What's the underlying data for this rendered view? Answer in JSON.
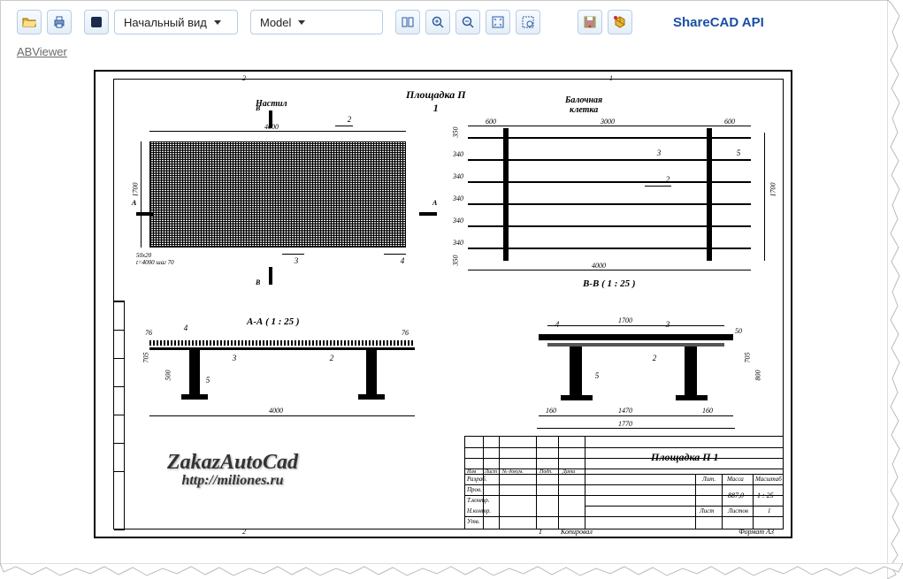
{
  "toolbar": {
    "view_select": "Начальный вид",
    "model_select": "Model",
    "api_link": "ShareCAD API"
  },
  "footer_link": "ABViewer",
  "drawing": {
    "main_title": "Площадка П",
    "main_title2": "1",
    "plan_label": "Настил",
    "beam_label": "Балочная\nклетка",
    "section_aa": "А-А ( 1 : 25 )",
    "section_bb": "В-В ( 1 : 25 )",
    "marks": {
      "a": "А",
      "b": "В"
    },
    "dims": {
      "w4000": "4000",
      "h1700": "1700",
      "d600_1": "600",
      "d3000": "3000",
      "d600_2": "600",
      "d340": "340",
      "grid_note": "50х20\nt=4000 шаг 70",
      "d705": "705",
      "d500": "500",
      "d76": "76",
      "d160": "160",
      "d1470": "1470",
      "d1770": "1770",
      "d1700e": "1700",
      "d800": "800",
      "d50_1": "50",
      "d350": "350"
    },
    "refs": {
      "r2": "2",
      "r3": "3",
      "r4": "4",
      "r5": "5"
    }
  },
  "titleblock": {
    "name": "Площадка П 1",
    "mass": "887,0",
    "scale": "1 : 25",
    "sheet": "Лист",
    "sheets": "Листов",
    "sheets_n": "1",
    "format": "Формат А3",
    "col_mass": "Масса",
    "col_scale": "Масштаб",
    "col_lit": "Лит.",
    "bottom_center": "Копировал",
    "left_labels": [
      "Разраб.",
      "Пров.",
      "Т.контр.",
      "Н.контр.",
      "Утв."
    ],
    "left_head": [
      "Изм",
      "Лист",
      "№ докум.",
      "Подп.",
      "Дата"
    ]
  },
  "watermark": {
    "line1": "ZakazAutoCad",
    "line2": "http://miliones.ru"
  },
  "page_marks": {
    "one": "1",
    "two": "2"
  }
}
